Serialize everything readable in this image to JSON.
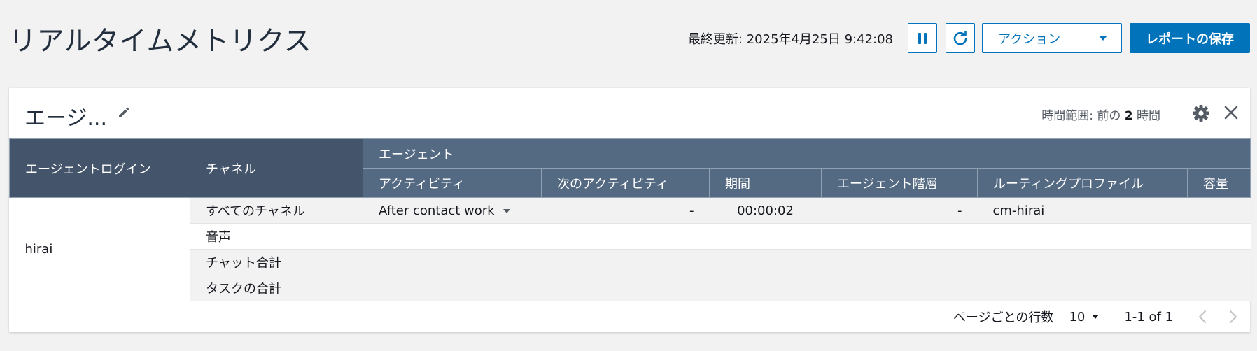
{
  "page": {
    "title": "リアルタイムメトリクス",
    "last_updated_label": "最終更新: 2025年4月25日 9:42:08",
    "action_label": "アクション",
    "save_label": "レポートの保存",
    "pause_icon": "pause-icon",
    "refresh_icon": "refresh-icon"
  },
  "widget": {
    "title": "エージ...",
    "time_range_prefix": "時間範囲: 前の",
    "time_range_value": "2",
    "time_range_unit": "時間",
    "headers": {
      "login": "エージェントログイン",
      "channel": "チャネル",
      "agent_group": "エージェント",
      "activity": "アクティビティ",
      "next_activity": "次のアクティビティ",
      "duration": "期間",
      "hierarchy": "エージェント階層",
      "routing_profile": "ルーティングプロファイル",
      "capacity": "容量"
    },
    "rows": [
      {
        "login": "hirai",
        "channels": [
          "すべてのチャネル",
          "音声",
          "チャット合計",
          "タスクの合計"
        ],
        "activity": "After contact work",
        "next_activity": "-",
        "duration": "00:00:02",
        "hierarchy": "-",
        "routing_profile": "cm-hirai",
        "capacity": ""
      }
    ],
    "pagination": {
      "rows_per_page_label": "ページごとの行数",
      "rows_per_page_value": "10",
      "range_label": "1-1 of 1"
    }
  },
  "colors": {
    "accent": "#0073bb",
    "header_bg": "#546a83",
    "header_dark_bg": "#44546a",
    "page_bg": "#f2f2f2"
  }
}
